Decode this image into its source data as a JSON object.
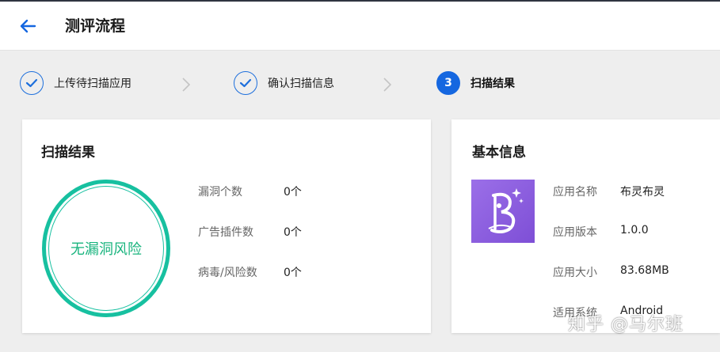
{
  "header": {
    "title": "测评流程",
    "back_icon": "arrow-left-icon"
  },
  "steps": [
    {
      "label": "上传待扫描应用",
      "status": "done",
      "icon": "check-icon"
    },
    {
      "label": "确认扫描信息",
      "status": "done",
      "icon": "check-icon"
    },
    {
      "label": "扫描结果",
      "status": "active",
      "number": "3"
    }
  ],
  "scan_result": {
    "title": "扫描结果",
    "verdict": "无漏洞风险",
    "stats": [
      {
        "label": "漏洞个数",
        "value": "0个"
      },
      {
        "label": "广告插件数",
        "value": "0个"
      },
      {
        "label": "病毒/风险数",
        "value": "0个"
      }
    ]
  },
  "basic_info": {
    "title": "基本信息",
    "rows": [
      {
        "label": "应用名称",
        "value": "布灵布灵"
      },
      {
        "label": "应用版本",
        "value": "1.0.0"
      },
      {
        "label": "应用大小",
        "value": "83.68MB"
      },
      {
        "label": "适用系统",
        "value": "Android"
      }
    ]
  },
  "watermark": "知乎 @马尔班",
  "colors": {
    "primary": "#1567e0",
    "success": "#17c0a0",
    "success_text": "#19b47e",
    "icon_bg": "#8b5ce0"
  }
}
